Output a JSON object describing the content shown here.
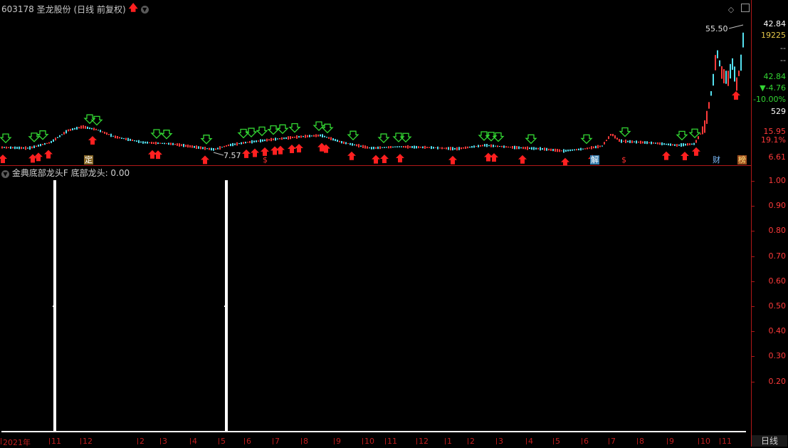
{
  "title": {
    "code": "603178",
    "name": "圣龙股份",
    "period": "(日线 前复权)"
  },
  "main_chart": {
    "price_axis": {
      "top_price": "42.84",
      "volume": "19225",
      "dash1": "--",
      "dash2": "--",
      "last_price": "42.84",
      "change": "▼-4.76",
      "change_pct": "-10.00%",
      "misc": "529",
      "level1": "15.95",
      "level1_pct": "19.1%",
      "bottom_price": "6.61"
    },
    "annotations": {
      "high_label": "55.50",
      "low_label": "7.57"
    },
    "event_badges": [
      {
        "text": "定",
        "kind": "ding"
      },
      {
        "text": "$",
        "kind": "dollar"
      },
      {
        "text": "解",
        "kind": "jie"
      },
      {
        "text": "$",
        "kind": "dollar"
      },
      {
        "text": "财",
        "kind": "cai"
      },
      {
        "text": "榜",
        "kind": "bang"
      }
    ],
    "colors": {
      "up": "#ff3a3a",
      "down": "#54e0ef",
      "buy_arrow": "#ff2020",
      "sell_arrow": "#33d633",
      "axis": "#b01818"
    }
  },
  "indicator": {
    "title": "金典底部龙头F",
    "value_label": "底部龙头: 0.00",
    "axis_ticks": [
      "1.00",
      "0.90",
      "0.80",
      "0.70",
      "0.60",
      "0.50",
      "0.40",
      "0.30",
      "0.20"
    ],
    "series_color": "#ffffff",
    "signals": [
      {
        "date_index": 0,
        "value": 1.0
      },
      {
        "date_index": 1,
        "value": 1.0
      }
    ]
  },
  "time_axis": [
    "2021年",
    "11",
    "12",
    "2",
    "3",
    "4",
    "5",
    "6",
    "7",
    "8",
    "9",
    "10",
    "11",
    "12",
    "1",
    "2",
    "3",
    "4",
    "5",
    "6",
    "7",
    "8",
    "9",
    "10",
    "11"
  ],
  "period_tab": "日线"
}
